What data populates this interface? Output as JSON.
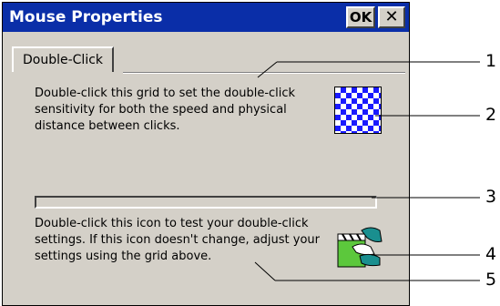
{
  "window": {
    "title": "Mouse Properties",
    "ok_label": "OK",
    "close_label": "✕"
  },
  "tabs": [
    {
      "label": "Double-Click"
    }
  ],
  "content": {
    "grid_description": "Double-click this grid to set the double-click sensitivity for both the speed and physical distance between clicks.",
    "test_description": "Double-click this icon to test your double-click settings. If this icon doesn't change, adjust your settings using the grid above."
  },
  "callouts": [
    "1",
    "2",
    "3",
    "4",
    "5"
  ],
  "colors": {
    "titlebar": "#0a2ea8",
    "face": "#d4d0c8",
    "grid_blue": "#1a1aff",
    "icon_green": "#5cc83c"
  },
  "icons": {
    "grid": "checkerboard-grid-icon",
    "test": "clapperboard-hand-icon"
  }
}
